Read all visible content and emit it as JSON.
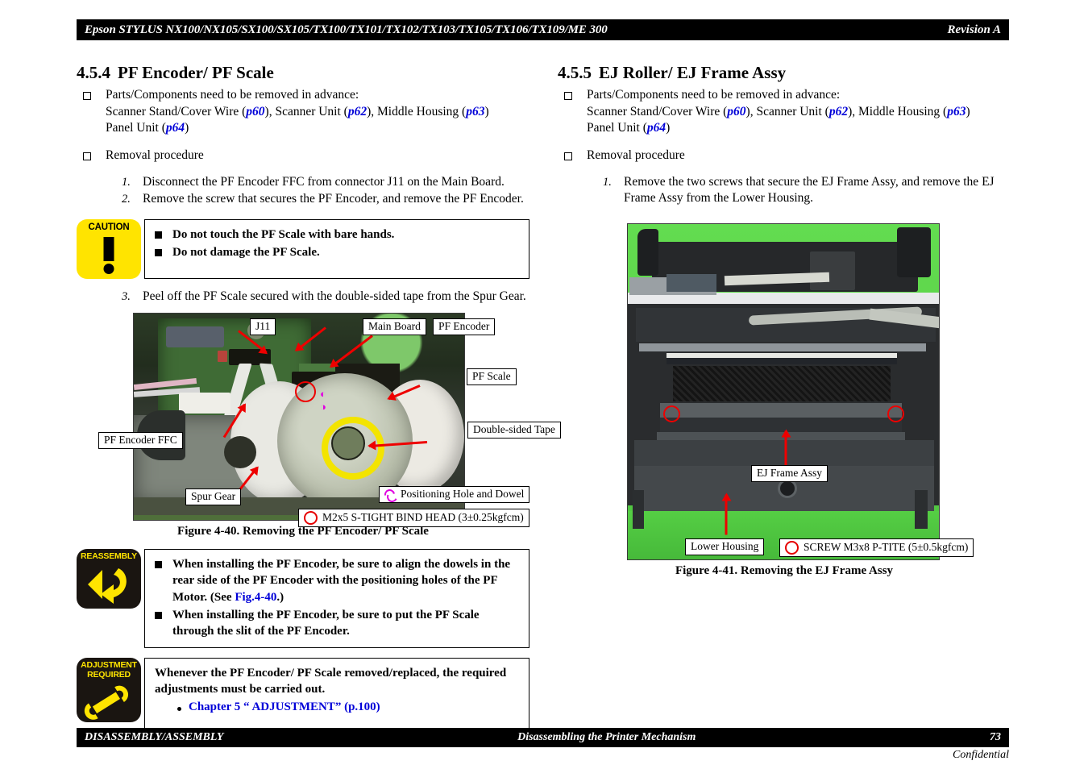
{
  "header": {
    "title": "Epson STYLUS NX100/NX105/SX100/SX105/TX100/TX101/TX102/TX103/TX105/TX106/TX109/ME 300",
    "revision": "Revision A"
  },
  "footer": {
    "left": "DISASSEMBLY/ASSEMBLY",
    "center": "Disassembling the Printer Mechanism",
    "page": "73",
    "confidential": "Confidential"
  },
  "left_section": {
    "number": "4.5.4",
    "title": "PF Encoder/ PF Scale",
    "prereq_label": "Parts/Components need to be removed in advance:",
    "prereq_line1_a": "Scanner Stand/Cover Wire (",
    "prereq_ref1": "p60",
    "prereq_line1_b": "), Scanner Unit (",
    "prereq_ref2": "p62",
    "prereq_line1_c": "), Middle Housing (",
    "prereq_ref3": "p63",
    "prereq_line1_d": ")",
    "prereq_line2_a": "Panel Unit (",
    "prereq_ref4": "p64",
    "prereq_line2_b": ")",
    "removal_label": "Removal procedure",
    "steps": [
      {
        "num": "1.",
        "text": "Disconnect the PF Encoder FFC from connector J11 on the Main Board."
      },
      {
        "num": "2.",
        "text": "Remove the screw that secures the PF Encoder, and remove the PF Encoder."
      }
    ],
    "step3": {
      "num": "3.",
      "text": "Peel off the PF Scale secured with the double-sided tape from the Spur Gear."
    },
    "caution": {
      "icon_title": "CAUTION",
      "lines": [
        "Do not touch the PF Scale with bare hands.",
        "Do not damage the PF Scale."
      ]
    },
    "reassembly": {
      "icon_title": "REASSEMBLY",
      "line1_a": "When installing the PF Encoder, be sure to align the dowels in the rear side of the PF Encoder with the positioning holes of the PF Motor. (See ",
      "line1_ref": "Fig.4-40",
      "line1_b": ".)",
      "line2": "When installing the PF Encoder, be sure to put the PF Scale through the slit of the PF Encoder."
    },
    "adjustment": {
      "icon_title_1": "ADJUSTMENT",
      "icon_title_2": "REQUIRED",
      "text": "Whenever the PF Encoder/ PF Scale removed/replaced, the required adjustments must be carried out.",
      "link": "Chapter 5 “ ADJUSTMENT” (p.100)"
    },
    "figure": {
      "caption": "Figure 4-40.  Removing the PF Encoder/ PF Scale",
      "callouts": [
        {
          "name": "j11",
          "text": "J11"
        },
        {
          "name": "main-board",
          "text": "Main Board"
        },
        {
          "name": "pf-encoder",
          "text": "PF Encoder"
        },
        {
          "name": "pf-scale",
          "text": "PF Scale"
        },
        {
          "name": "double-sided-tape",
          "text": "Double-sided Tape"
        },
        {
          "name": "pf-encoder-ffc",
          "text": "PF Encoder FFC"
        },
        {
          "name": "spur-gear",
          "text": "Spur Gear"
        },
        {
          "name": "positioning-hole",
          "text": "Positioning Hole and Dowel"
        },
        {
          "name": "screw-spec",
          "text": "M2x5 S-TIGHT BIND HEAD (3±0.25kgfcm)"
        }
      ]
    }
  },
  "right_section": {
    "number": "4.5.5",
    "title": "EJ Roller/ EJ Frame Assy",
    "prereq_label": "Parts/Components need to be removed in advance:",
    "prereq_line1_a": "Scanner Stand/Cover Wire (",
    "prereq_ref1": "p60",
    "prereq_line1_b": "), Scanner Unit (",
    "prereq_ref2": "p62",
    "prereq_line1_c": "), Middle Housing (",
    "prereq_ref3": "p63",
    "prereq_line1_d": ")",
    "prereq_line2_a": "Panel Unit (",
    "prereq_ref4": "p64",
    "prereq_line2_b": ")",
    "removal_label": "Removal procedure",
    "steps": [
      {
        "num": "1.",
        "text": "Remove the two screws that secure the EJ Frame Assy, and remove the EJ Frame Assy from the Lower Housing."
      }
    ],
    "figure": {
      "caption": "Figure 4-41.  Removing the EJ Frame Assy",
      "callouts": [
        {
          "name": "ej-frame-assy",
          "text": "EJ Frame Assy"
        },
        {
          "name": "lower-housing",
          "text": "Lower Housing"
        },
        {
          "name": "screw-spec",
          "text": "SCREW M3x8 P-TITE (5±0.5kgfcm)"
        }
      ]
    }
  },
  "colors": {
    "caution_yellow": "#ffe400",
    "icon_dark": "#1a1511",
    "link_blue": "#0000d8",
    "arrow_red": "#ee0000",
    "photo_green": "#5cd64a"
  }
}
